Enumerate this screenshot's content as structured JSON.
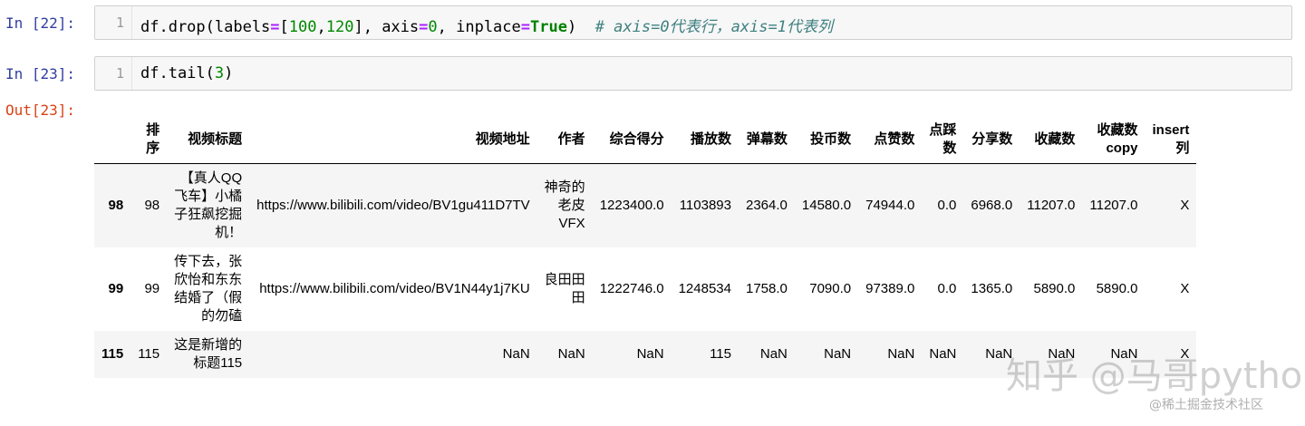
{
  "cells": {
    "cell22": {
      "prompt": "In [22]:",
      "line": "1",
      "code": {
        "t1": "df.drop(labels",
        "eq1": "=",
        "t2": "[",
        "n1": "100",
        "t3": ",",
        "n2": "120",
        "t4": "], axis",
        "eq2": "=",
        "n3": "0",
        "t5": ", inplace",
        "eq3": "=",
        "kw": "True",
        "t6": ")  ",
        "comment": "# axis=0代表行，axis=1代表列"
      }
    },
    "cell23": {
      "prompt": "In [23]:",
      "line": "1",
      "code": {
        "t1": "df.tail(",
        "n1": "3",
        "t2": ")"
      },
      "out_prompt": "Out[23]:"
    }
  },
  "table": {
    "columns": [
      "排\n序",
      "视频标题",
      "视频地址",
      "作者",
      "综合得分",
      "播放数",
      "弹幕数",
      "投币数",
      "点赞数",
      "点踩\n数",
      "分享数",
      "收藏数",
      "收藏数\ncopy",
      "insert\n列"
    ],
    "rows": [
      {
        "index": "98",
        "cells": [
          "98",
          "【真人QQ\n飞车】小橘\n子狂飙挖掘\n机！",
          "https://www.bilibili.com/video/BV1gu411D7TV",
          "神奇的\n老皮\nVFX",
          "1223400.0",
          "1103893",
          "2364.0",
          "14580.0",
          "74944.0",
          "0.0",
          "6968.0",
          "11207.0",
          "11207.0",
          "X"
        ]
      },
      {
        "index": "99",
        "cells": [
          "99",
          "传下去，张\n欣怡和东东\n结婚了（假\n的勿磕",
          "https://www.bilibili.com/video/BV1N44y1j7KU",
          "良田田\n田",
          "1222746.0",
          "1248534",
          "1758.0",
          "7090.0",
          "97389.0",
          "0.0",
          "1365.0",
          "5890.0",
          "5890.0",
          "X"
        ]
      },
      {
        "index": "115",
        "cells": [
          "115",
          "这是新增的\n标题115",
          "NaN",
          "NaN",
          "NaN",
          "115",
          "NaN",
          "NaN",
          "NaN",
          "NaN",
          "NaN",
          "NaN",
          "NaN",
          "X"
        ]
      }
    ]
  },
  "watermark": {
    "main": "知乎 @马哥python说",
    "sub": "@稀土掘金技术社区"
  }
}
